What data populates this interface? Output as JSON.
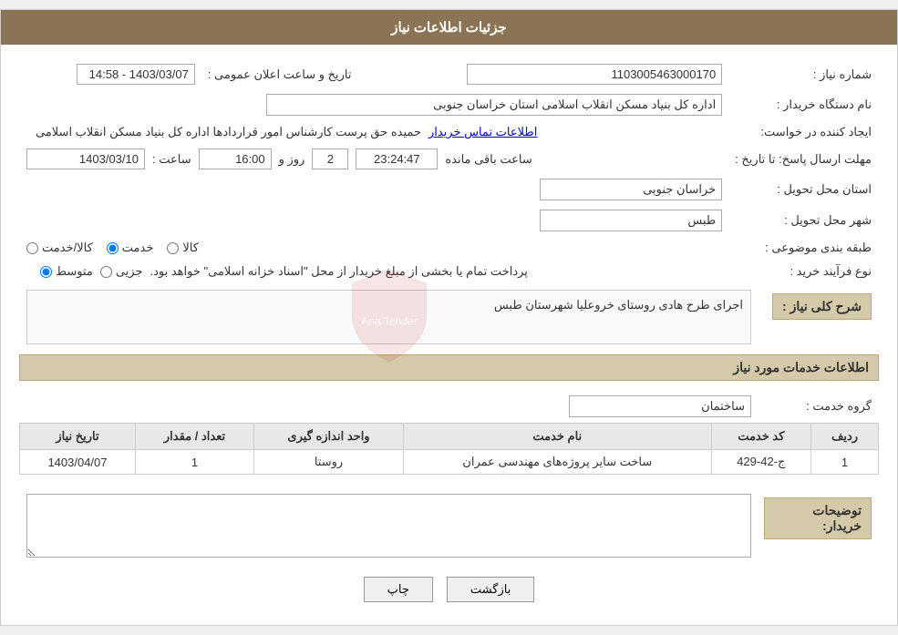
{
  "header": {
    "title": "جزئیات اطلاعات نیاز"
  },
  "fields": {
    "need_number_label": "شماره نیاز :",
    "need_number_value": "1103005463000170",
    "announce_date_label": "تاریخ و ساعت اعلان عمومی :",
    "announce_date_value": "1403/03/07 - 14:58",
    "buyer_org_label": "نام دستگاه خریدار :",
    "buyer_org_value": "اداره کل بنیاد مسکن انقلاب اسلامی استان خراسان جنوبی",
    "creator_label": "ایجاد کننده در خواست:",
    "creator_value": "حمیده حق پرست کارشناس امور قراردادها اداره کل بنیاد مسکن انقلاب اسلامی",
    "contact_link": "اطلاعات تماس خریدار",
    "deadline_label": "مهلت ارسال پاسخ: تا تاریخ :",
    "deadline_date": "1403/03/10",
    "deadline_time_label": "ساعت :",
    "deadline_time": "16:00",
    "deadline_days_label": "روز و",
    "deadline_days": "2",
    "deadline_remaining_label": "ساعت باقی مانده",
    "deadline_remaining_time": "23:24:47",
    "province_label": "استان محل تحویل :",
    "province_value": "خراسان جنوبی",
    "city_label": "شهر محل تحویل :",
    "city_value": "طبس",
    "category_label": "طبقه بندی موضوعی :",
    "category_options": [
      {
        "id": "kala",
        "label": "کالا"
      },
      {
        "id": "khadamat",
        "label": "خدمت"
      },
      {
        "id": "kala_khadamat",
        "label": "کالا/خدمت"
      }
    ],
    "category_selected": "khadamat",
    "purchase_type_label": "نوع فرآیند خرید :",
    "purchase_type_options": [
      {
        "id": "jozi",
        "label": "جزیی"
      },
      {
        "id": "motavaset",
        "label": "متوسط"
      }
    ],
    "purchase_type_selected": "motavaset",
    "purchase_type_note": "پرداخت تمام یا بخشی از مبلغ خریدار از محل \"اسناد خزانه اسلامی\" خواهد بود.",
    "need_description_label": "شرح کلی نیاز :",
    "need_description_value": "اجرای طرح هادی روستای خروعلیا شهرستان طبس",
    "services_section_title": "اطلاعات خدمات مورد نیاز",
    "service_group_label": "گروه خدمت :",
    "service_group_value": "ساختمان",
    "table_headers": [
      "ردیف",
      "کد خدمت",
      "نام خدمت",
      "واحد اندازه گیری",
      "تعداد / مقدار",
      "تاریخ نیاز"
    ],
    "table_rows": [
      {
        "row": "1",
        "code": "ج-42-429",
        "name": "ساخت سایر پروژه‌های مهندسی عمران",
        "unit": "روستا",
        "count": "1",
        "date": "1403/04/07"
      }
    ],
    "buyer_desc_label": "توضیحات خریدار:",
    "buyer_desc_value": ""
  },
  "buttons": {
    "print": "چاپ",
    "back": "بازگشت"
  }
}
